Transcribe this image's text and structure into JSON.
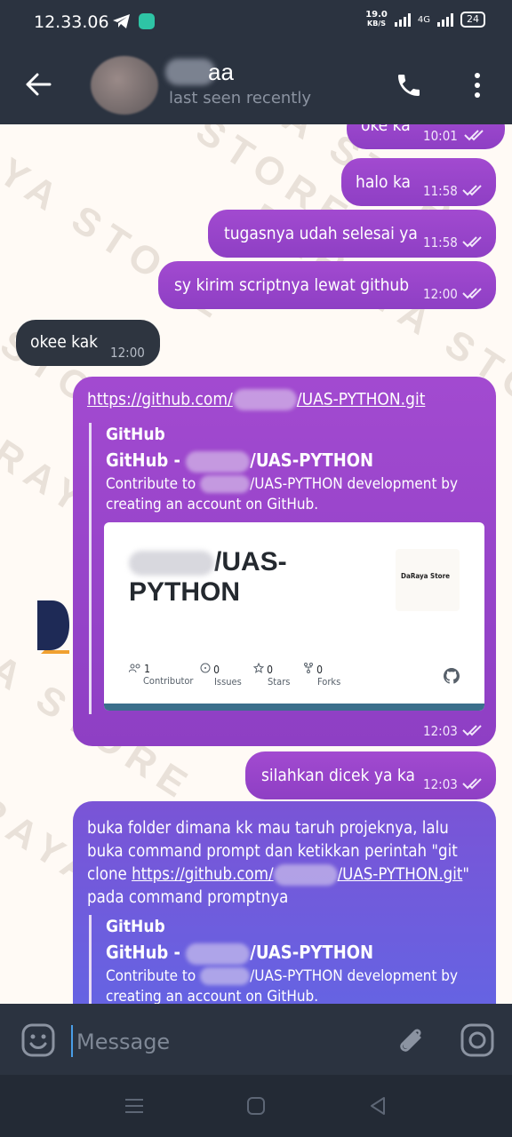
{
  "status_bar": {
    "time": "12.33.06",
    "net_speed_value": "19.0",
    "net_speed_unit": "KB/S",
    "network": "4G",
    "battery": "24"
  },
  "header": {
    "contact_name": "aa",
    "last_seen": "last seen recently"
  },
  "messages": [
    {
      "id": "m1",
      "direction": "out",
      "text": "oke ka",
      "time": "10:01"
    },
    {
      "id": "m2",
      "direction": "out",
      "text": "halo ka",
      "time": "11:58"
    },
    {
      "id": "m3",
      "direction": "out",
      "text": "tugasnya udah selesai ya",
      "time": "11:58"
    },
    {
      "id": "m4",
      "direction": "out",
      "text": "sy kirim scriptnya lewat github",
      "time": "12:00"
    },
    {
      "id": "m5",
      "direction": "in",
      "text": "okee kak",
      "time": "12:00"
    },
    {
      "id": "m6",
      "direction": "out",
      "link_prefix": "https://github.com/",
      "link_suffix": "/UAS-PYTHON.git",
      "time": "12:03",
      "preview": {
        "site": "GitHub",
        "title_prefix": "GitHub -",
        "title_suffix": "/UAS-PYTHON",
        "desc_prefix": "Contribute to",
        "desc_suffix": "/UAS-PYTHON development by",
        "desc_line2": "creating an account on GitHub.",
        "card": {
          "repo_line1": "/UAS-",
          "repo_line2": "PYTHON",
          "logo_text": "DaRaya Store",
          "stats": [
            {
              "label": "Contributor",
              "value": "1",
              "icon": "people-icon"
            },
            {
              "label": "Issues",
              "value": "0",
              "icon": "issue-icon"
            },
            {
              "label": "Stars",
              "value": "0",
              "icon": "star-icon"
            },
            {
              "label": "Forks",
              "value": "0",
              "icon": "fork-icon"
            }
          ]
        }
      }
    },
    {
      "id": "m7",
      "direction": "out",
      "text": "silahkan dicek ya ka",
      "time": "12:03"
    },
    {
      "id": "m8",
      "direction": "out",
      "line1": "buka folder dimana kk mau taruh projeknya, lalu",
      "line2": "buka command prompt dan ketikkan perintah \"git",
      "line3_prefix": "clone",
      "link_prefix": "https://github.com/",
      "link_suffix": "/UAS-PYTHON.git",
      "line3_end": "\"",
      "line4": "pada command promptnya",
      "preview": {
        "site": "GitHub",
        "title_prefix": "GitHub -",
        "title_suffix": "/UAS-PYTHON",
        "desc_prefix": "Contribute to",
        "desc_suffix": "/UAS-PYTHON development by",
        "desc_line2": "creating an account on GitHub."
      }
    }
  ],
  "watermark": "DARAYA STORE",
  "input": {
    "placeholder": "Message"
  },
  "colors": {
    "accent": "#9b45cc",
    "bar": "#2b3340",
    "link_blue": "#4a9ee8"
  }
}
